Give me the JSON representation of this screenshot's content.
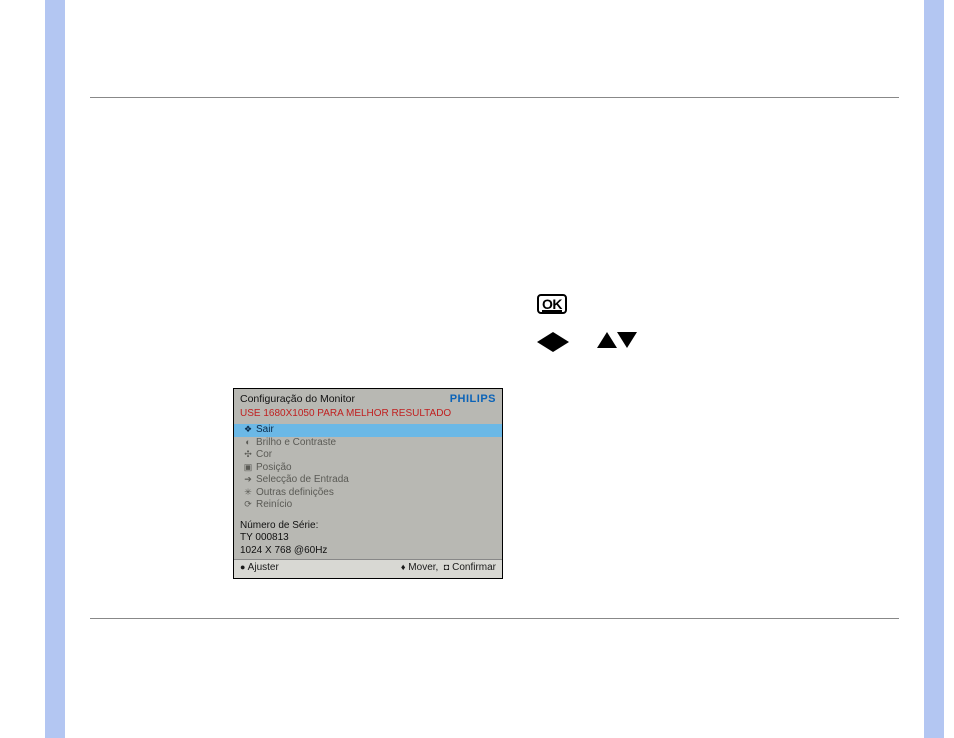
{
  "icons": {
    "ok_label": "OK"
  },
  "osd": {
    "title": "Configuração do Monitor",
    "brand": "PHILIPS",
    "recommend": "USE 1680X1050 PARA MELHOR RESULTADO",
    "items": [
      {
        "glyph": "❖",
        "label": "Sair",
        "selected": true
      },
      {
        "glyph": "◐",
        "label": "Brilho e Contraste",
        "selected": false
      },
      {
        "glyph": "✣",
        "label": "Cor",
        "selected": false
      },
      {
        "glyph": "▣",
        "label": "Posição",
        "selected": false
      },
      {
        "glyph": "➔",
        "label": "Selecção de Entrada",
        "selected": false
      },
      {
        "glyph": "✳",
        "label": "Outras definições",
        "selected": false
      },
      {
        "glyph": "⟳",
        "label": "Reinício",
        "selected": false
      }
    ],
    "serial_label": "Número de Série:",
    "serial_value": "TY 000813",
    "mode": "1024 X 768 @60Hz",
    "footer_left": "Ajuster",
    "footer_right_move": "Mover,",
    "footer_right_confirm": "Confirmar"
  }
}
